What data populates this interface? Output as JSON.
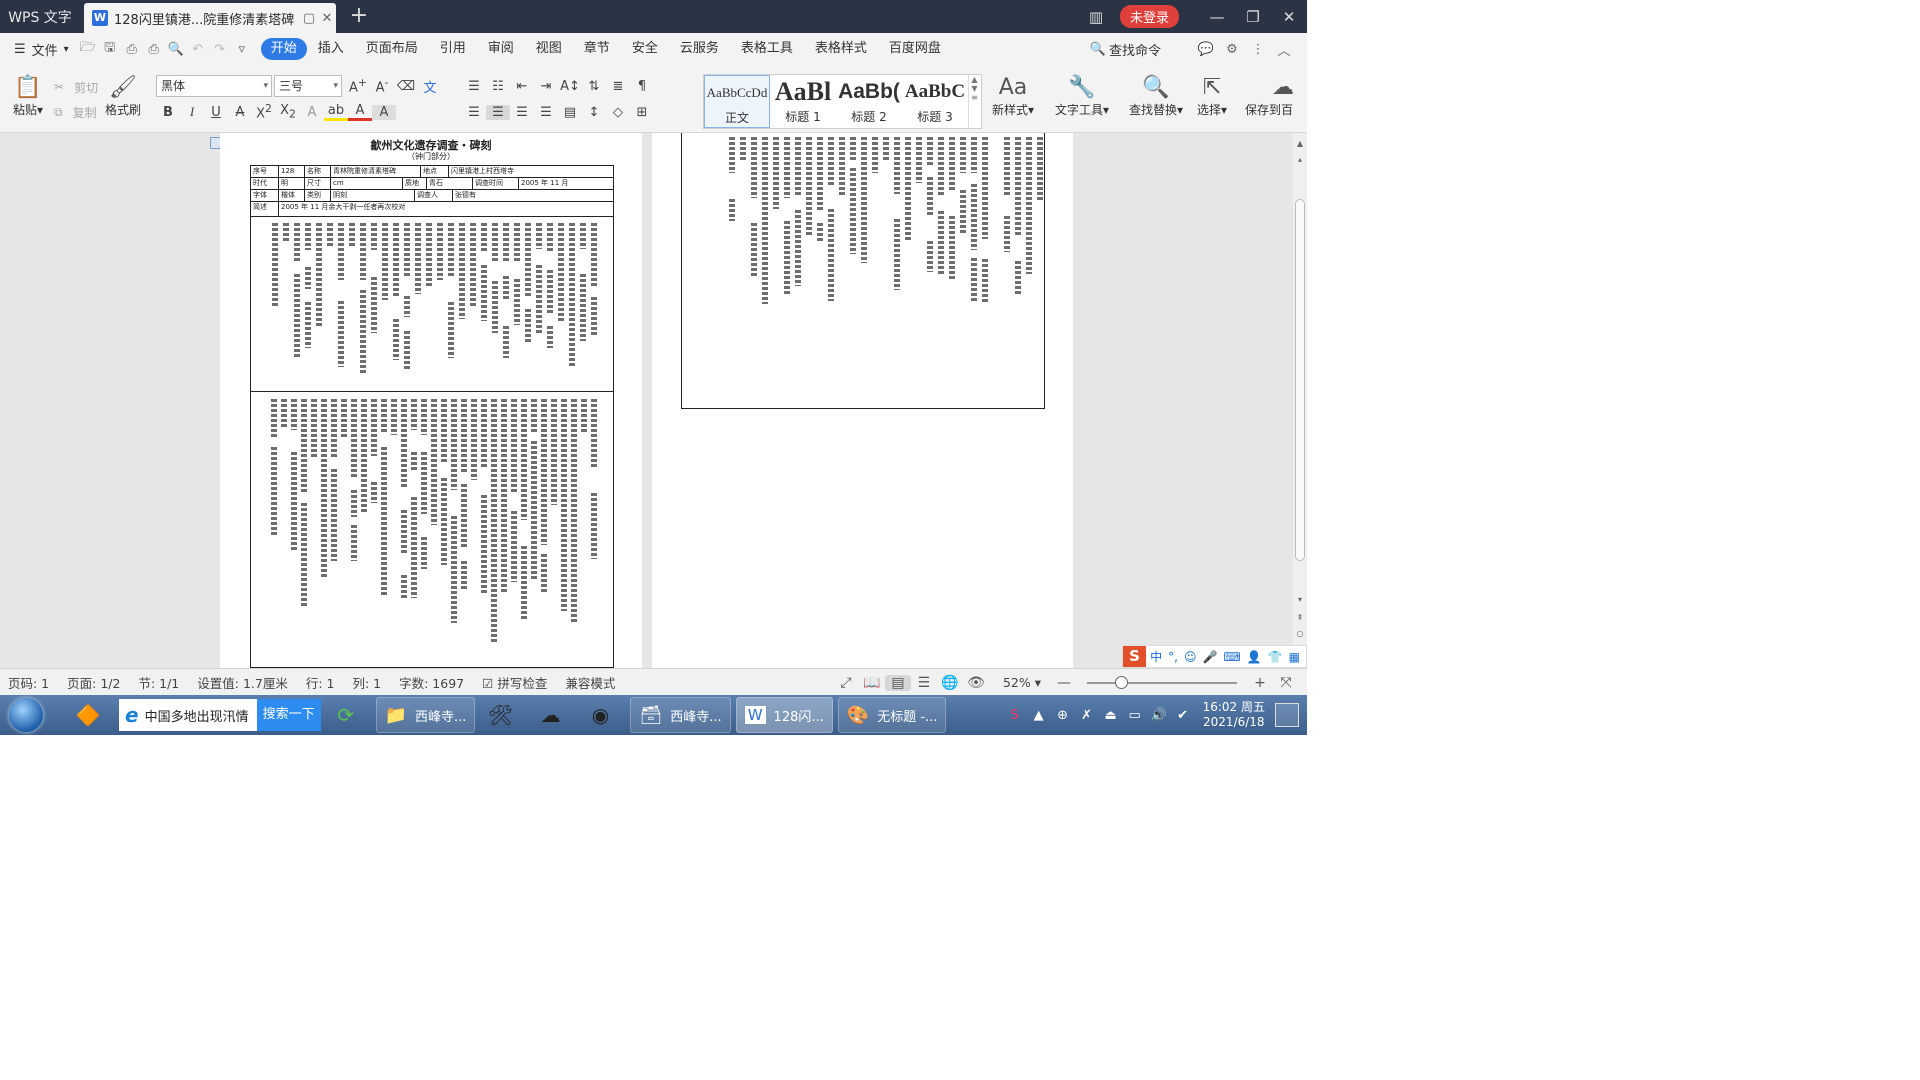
{
  "titlebar": {
    "app_tab": "WPS 文字",
    "doc_tab_title": "128闪里镇港...院重修清素塔碑",
    "new_tab_icon": "plus-icon",
    "login_label": "未登录"
  },
  "menubar": {
    "file_label": "文件",
    "items": [
      "开始",
      "插入",
      "页面布局",
      "引用",
      "审阅",
      "视图",
      "章节",
      "安全",
      "云服务",
      "表格工具",
      "表格样式",
      "百度网盘"
    ],
    "active_index": 0,
    "search_label": "查找命令"
  },
  "ribbon": {
    "paste_label": "粘贴",
    "cut_label": "剪切",
    "copy_label": "复制",
    "format_painter_label": "格式刷",
    "font_name": "黑体",
    "font_size": "三号",
    "styles": [
      {
        "preview": "AaBbCcDd",
        "name": "正文"
      },
      {
        "preview": "AaBl",
        "name": "标题 1"
      },
      {
        "preview": "AaBb(",
        "name": "标题 2"
      },
      {
        "preview": "AaBbC",
        "name": "标题 3"
      }
    ],
    "new_style_label": "新样式",
    "text_tools_label": "文字工具",
    "find_replace_label": "查找替换",
    "select_label": "选择",
    "save_to_label": "保存到百"
  },
  "document": {
    "title": "歙州文化遗存调查・碑刻",
    "subtitle": "（钟门部分）",
    "table": {
      "row1": [
        "序号",
        "128",
        "名称",
        "青林院重修清素塔碑",
        "地点",
        "闪里镇港上村西塔寺"
      ],
      "row2": [
        "时代",
        "明",
        "尺寸",
        "cm",
        "质地",
        "青石",
        "调查时间",
        "2005 年 11 月"
      ],
      "row3": [
        "字体",
        "楷体",
        "类别",
        "阴刻",
        "调查人",
        "张德有"
      ],
      "row4": [
        "简述",
        "2005 年 11 月余大干剥一任者再次校对"
      ]
    }
  },
  "statusbar": {
    "page_num": "页码: 1",
    "pages": "页面: 1/2",
    "section": "节: 1/1",
    "setting": "设置值: 1.7厘米",
    "row": "行: 1",
    "col": "列: 1",
    "word_count": "字数: 1697",
    "spell_check": "拼写检查",
    "compat_mode": "兼容模式",
    "zoom": "52%",
    "zoom_fraction": 0.2
  },
  "ime": {
    "lang": "中"
  },
  "taskbar": {
    "ie_text": "中国多地出现汛情",
    "ie_search": "搜索一下",
    "tasks": [
      "西峰寺...",
      "西峰寺...",
      "128闪...",
      "无标题 -..."
    ],
    "active_task": 2,
    "clock_time": "16:02 周五",
    "clock_date": "2021/6/18"
  },
  "colors": {
    "titlebar_bg": "#2b3445",
    "accent": "#2f7be5",
    "login_red": "#e0403b"
  }
}
